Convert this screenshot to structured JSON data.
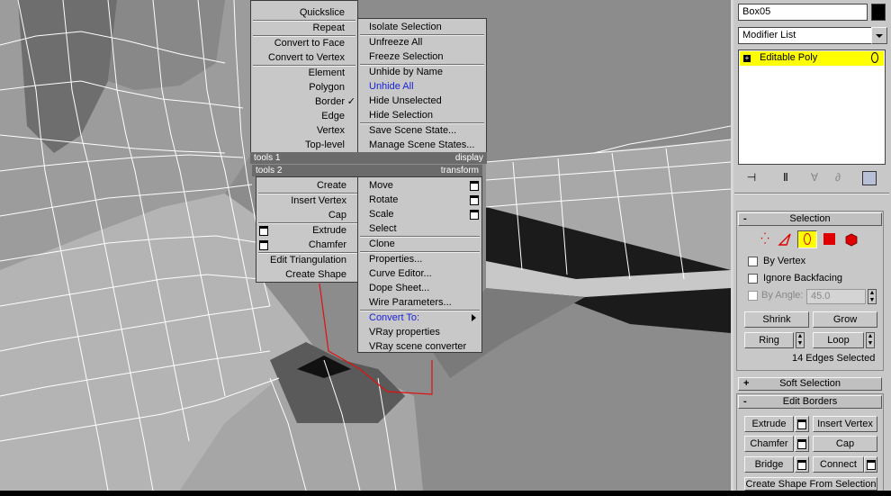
{
  "menus": {
    "top_left": {
      "items": [
        "Quickslice",
        "Repeat",
        "Convert to Face",
        "Convert to Vertex",
        "Element",
        "Polygon",
        "Border",
        "Edge",
        "Vertex",
        "Top-level"
      ],
      "check_mark": "✓",
      "footer": "tools 1"
    },
    "top_right": {
      "items": [
        "Isolate Selection",
        "Unfreeze All",
        "Freeze Selection",
        "Unhide by Name",
        "Unhide All",
        "Hide Unselected",
        "Hide Selection",
        "Save Scene State...",
        "Manage Scene States..."
      ],
      "footer": "display"
    },
    "bottom_left": {
      "header": "tools 2",
      "items": [
        "Create",
        "Insert Vertex",
        "Cap",
        "Extrude",
        "Chamfer",
        "Edit Triangulation",
        "Create Shape"
      ]
    },
    "bottom_right": {
      "header": "transform",
      "items": [
        "Move",
        "Rotate",
        "Scale",
        "Select",
        "Clone",
        "Properties...",
        "Curve Editor...",
        "Dope Sheet...",
        "Wire Parameters...",
        "Convert To:",
        "VRay properties",
        "VRay scene converter"
      ]
    },
    "highlight_color": "#1a22d8"
  },
  "panel": {
    "object_name": "Box05",
    "object_color": "#000000",
    "modifier_list": "Modifier List",
    "stack_item": "Editable Poly",
    "stack_highlight": "#ffff00",
    "selection": {
      "title": "Selection",
      "by_vertex": "By Vertex",
      "ignore_backfacing": "Ignore Backfacing",
      "by_angle": "By Angle:",
      "angle_value": "45.0",
      "shrink": "Shrink",
      "grow": "Grow",
      "ring": "Ring",
      "loop": "Loop",
      "status": "14 Edges Selected"
    },
    "soft_selection": {
      "title": "Soft Selection"
    },
    "edit_borders": {
      "title": "Edit Borders",
      "extrude": "Extrude",
      "insert_vertex": "Insert Vertex",
      "chamfer": "Chamfer",
      "cap": "Cap",
      "bridge": "Bridge",
      "connect": "Connect",
      "create_shape": "Create Shape From Selection"
    }
  }
}
